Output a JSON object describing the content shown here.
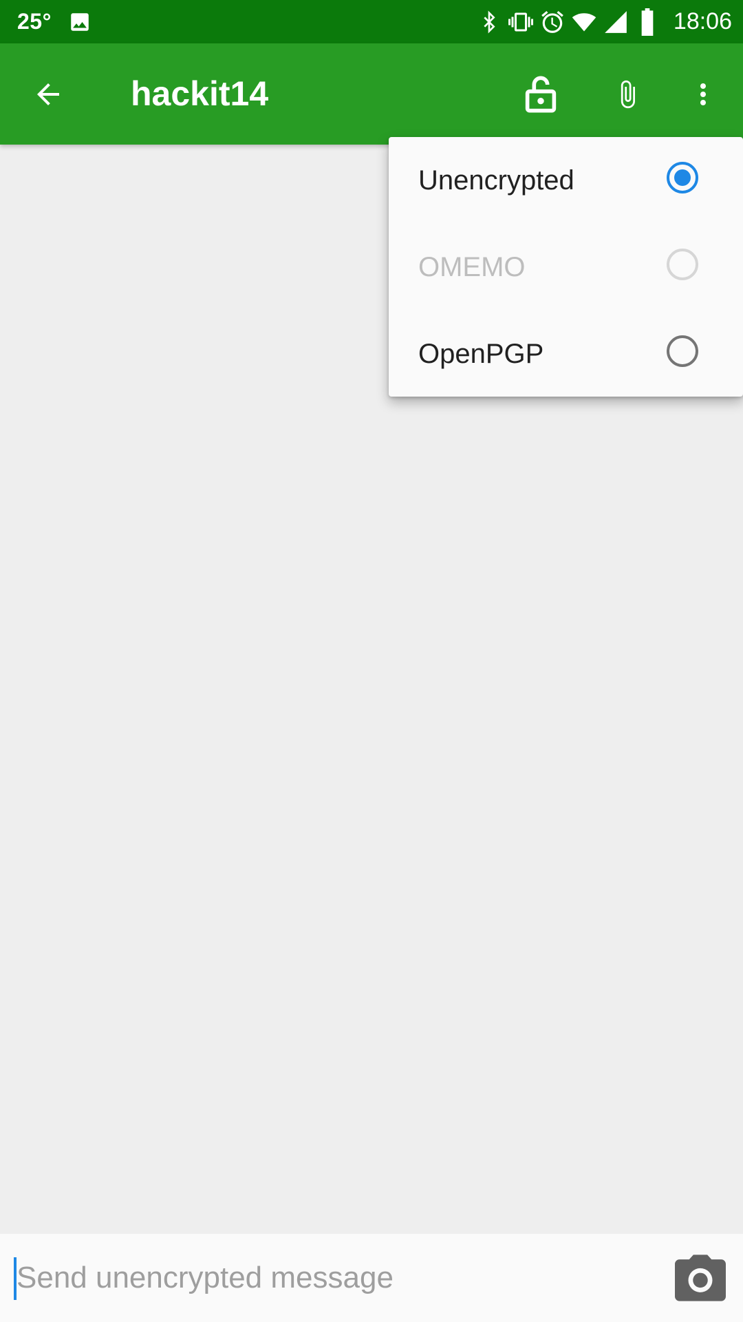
{
  "status_bar": {
    "temperature": "25°",
    "time": "18:06",
    "icons": [
      "gallery-icon",
      "bluetooth-icon",
      "vibrate-icon",
      "alarm-icon",
      "wifi-icon",
      "signal-icon",
      "battery-icon"
    ]
  },
  "app_bar": {
    "title": "hackit14",
    "actions": [
      "back-arrow-icon",
      "lock-open-icon",
      "attach-icon",
      "more-vert-icon"
    ]
  },
  "encryption_menu": {
    "items": [
      {
        "label": "Unencrypted",
        "selected": true,
        "enabled": true
      },
      {
        "label": "OMEMO",
        "selected": false,
        "enabled": false
      },
      {
        "label": "OpenPGP",
        "selected": false,
        "enabled": true
      }
    ]
  },
  "composer": {
    "placeholder": "Send unencrypted message",
    "value": ""
  },
  "colors": {
    "status_bar": "#0b7a0b",
    "app_bar": "#289c24",
    "radio_selected": "#1e88e5",
    "background": "#eeeeee"
  }
}
